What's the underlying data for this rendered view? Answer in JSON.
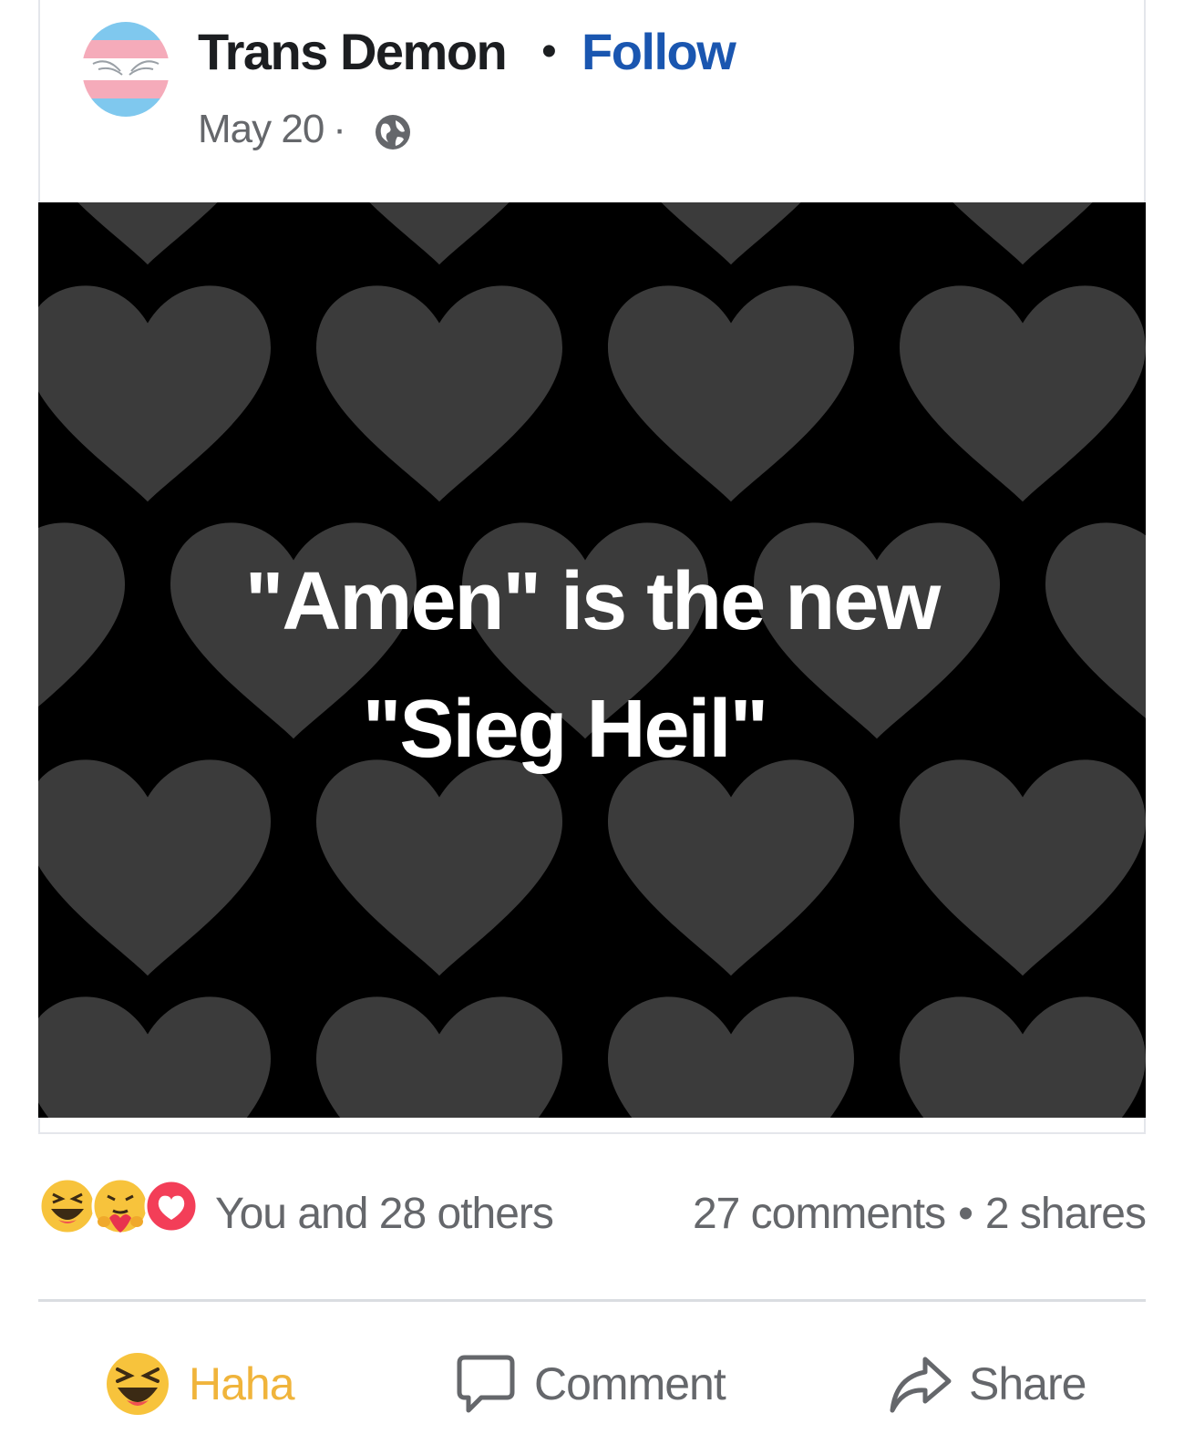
{
  "post": {
    "author": "Trans Demon",
    "separator": "•",
    "follow_label": "Follow",
    "date": "May 20",
    "date_separator": "·",
    "privacy_icon": "globe-icon",
    "image_text_line1": "\"Amen\" is the new",
    "image_text_line2": "\"Sieg Heil\""
  },
  "stats": {
    "reaction_icons": [
      "haha-icon",
      "care-icon",
      "love-icon"
    ],
    "reactions_text": "You and 28 others",
    "comments": "27 comments",
    "separator": "•",
    "shares": "2 shares"
  },
  "actions": {
    "haha_label": "Haha",
    "comment_label": "Comment",
    "share_label": "Share"
  },
  "colors": {
    "follow": "#1a56b0",
    "haha_active": "#f0b43b",
    "muted_text": "#65676b",
    "image_bg": "#000000",
    "heart": "#3b3b3b"
  }
}
